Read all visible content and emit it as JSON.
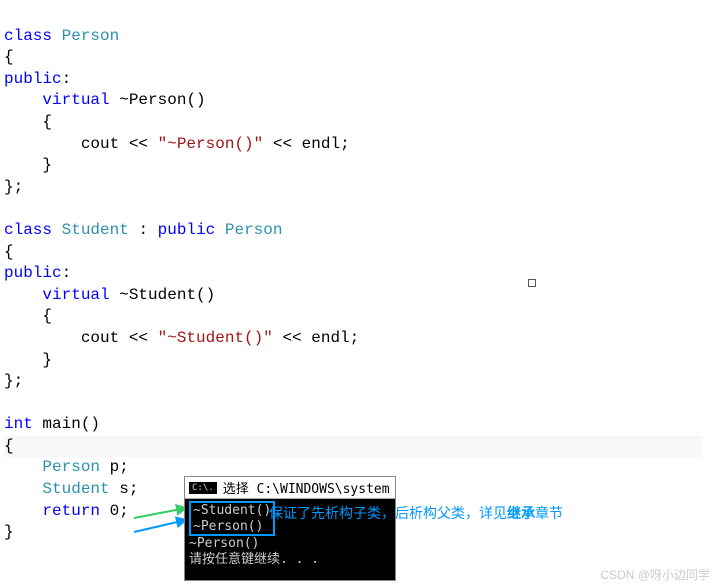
{
  "code": {
    "l1_kw": "class",
    "l1_type": "Person",
    "l2": "{",
    "l3_kw": "public",
    "l3_colon": ":",
    "l4_kw": "virtual",
    "l4_rest": " ~Person()",
    "l5": "    {",
    "l6_a": "        cout << ",
    "l6_str": "\"~Person()\"",
    "l6_b": " << endl;",
    "l7": "    }",
    "l8": "};",
    "l9": "",
    "l10_kw": "class",
    "l10_type1": "Student",
    "l10_mid": " : ",
    "l10_kw2": "public",
    "l10_type2": "Person",
    "l11": "{",
    "l12_kw": "public",
    "l12_colon": ":",
    "l13_kw": "virtual",
    "l13_rest": " ~Student()",
    "l14": "    {",
    "l15_a": "        cout << ",
    "l15_str": "\"~Student()\"",
    "l15_b": " << endl;",
    "l16": "    }",
    "l17": "};",
    "l18": "",
    "l19_kw": "int",
    "l19_rest": " main()",
    "l20": "{",
    "l21_type": "Person",
    "l21_rest": " p;",
    "l22_type": "Student",
    "l22_rest": " s;",
    "l23_kw": "return",
    "l23_rest": " 0;",
    "l24": "}"
  },
  "console": {
    "icon": "C:\\.",
    "title": "选择 C:\\WINDOWS\\system",
    "line1": "~Student()",
    "line2": "~Person()",
    "line3": "~Person()",
    "line4": "请按任意键继续. . ."
  },
  "annotation": {
    "text_a": "保证了先析构子类，后析构父类，详见",
    "text_bold": "继承",
    "text_b": "章节"
  },
  "watermark": "CSDN @呀小边同学"
}
